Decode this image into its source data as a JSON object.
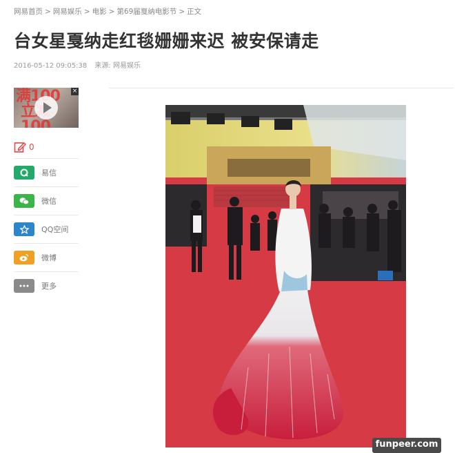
{
  "breadcrumb": {
    "items": [
      "网易首页",
      "网易娱乐",
      "电影",
      "第69届戛纳电影节",
      "正文"
    ],
    "separator": ">"
  },
  "article": {
    "title": "台女星戛纳走红毯姗姗来迟 被安保请走",
    "date": "2016-05-12 09:05:38",
    "source": "来源: 网易娱乐"
  },
  "ad": {
    "text_line1": "满100",
    "text_line2": "立减100",
    "close_label": "×",
    "play_icon": "play-icon"
  },
  "comments": {
    "count": "0",
    "icon": "edit-icon"
  },
  "share": {
    "items": [
      {
        "label": "易信",
        "icon": "yixin-icon",
        "color": "#25a86b"
      },
      {
        "label": "微信",
        "icon": "wechat-icon",
        "color": "#3bb44a"
      },
      {
        "label": "QQ空间",
        "icon": "qzone-icon",
        "color": "#2d86c9"
      },
      {
        "label": "微博",
        "icon": "weibo-icon",
        "color": "#f0a023"
      },
      {
        "label": "更多",
        "icon": "more-icon",
        "color": "#8a8a8a"
      }
    ]
  },
  "watermark": {
    "text": "funpeer.com"
  },
  "colors": {
    "carpet": "#d63b45",
    "dress_red": "#c81e3c",
    "text_dark": "#333333",
    "meta_grey": "#999999"
  }
}
